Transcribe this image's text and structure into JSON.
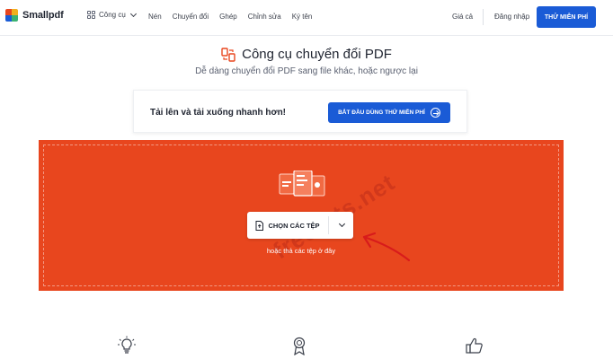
{
  "brand": {
    "name": "Smallpdf"
  },
  "nav": {
    "tools_label": "Công cụ",
    "links": [
      "Nén",
      "Chuyển đổi",
      "Ghép",
      "Chỉnh sửa",
      "Ký tên"
    ],
    "pricing": "Giá cả",
    "login": "Đăng nhập",
    "cta": "THỬ MIỄN PHÍ"
  },
  "hero": {
    "title": "Công cụ chuyển đổi PDF",
    "subtitle": "Dễ dàng chuyển đổi PDF sang file khác, hoặc ngược lại"
  },
  "promo": {
    "text": "Tải lên và tải xuống nhanh hơn!",
    "button": "BẮT ĐẦU DÙNG THỬ MIỄN PHÍ"
  },
  "dropzone": {
    "choose_label": "CHỌN CÁC TỆP",
    "hint": "hoặc thả các tệp ở đây",
    "watermark": "freetuts.net"
  },
  "colors": {
    "accent": "#1a5bd6",
    "drop_bg": "#e8461e",
    "annotation": "#d81b1b"
  },
  "icons": {
    "feature_1": "lightbulb-icon",
    "feature_2": "award-icon",
    "feature_3": "thumbs-up-icon"
  }
}
